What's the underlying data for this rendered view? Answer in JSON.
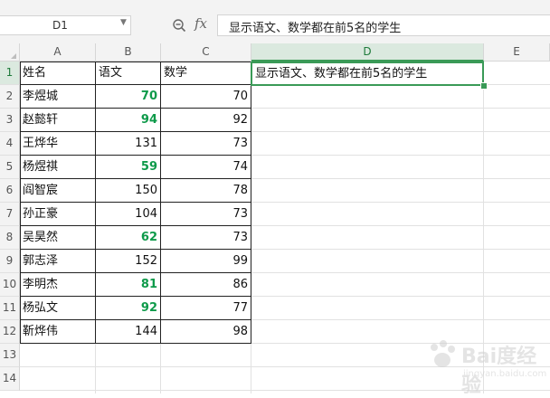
{
  "formula_bar": {
    "name_box": "D1",
    "fx_label": "fx",
    "formula": "显示语文、数学都在前5名的学生"
  },
  "columns": [
    "A",
    "B",
    "C",
    "D",
    "E"
  ],
  "active_column": "D",
  "rows": [
    "1",
    "2",
    "3",
    "4",
    "5",
    "6",
    "7",
    "8",
    "9",
    "10",
    "11",
    "12",
    "13",
    "14"
  ],
  "active_row": "1",
  "header": {
    "name": "姓名",
    "chinese": "语文",
    "math": "数学",
    "d1": "显示语文、数学都在前5名的学生"
  },
  "students": [
    {
      "name": "李煜城",
      "chinese": "70",
      "math": "70",
      "top5": true
    },
    {
      "name": "赵懿轩",
      "chinese": "94",
      "math": "92",
      "top5": true
    },
    {
      "name": "王烨华",
      "chinese": "131",
      "math": "73",
      "top5": false
    },
    {
      "name": "杨煜祺",
      "chinese": "59",
      "math": "74",
      "top5": true
    },
    {
      "name": "阎智宸",
      "chinese": "150",
      "math": "78",
      "top5": false
    },
    {
      "name": "孙正豪",
      "chinese": "104",
      "math": "73",
      "top5": false
    },
    {
      "name": "吴昊然",
      "chinese": "62",
      "math": "73",
      "top5": true
    },
    {
      "name": "郭志泽",
      "chinese": "152",
      "math": "99",
      "top5": false
    },
    {
      "name": "李明杰",
      "chinese": "81",
      "math": "86",
      "top5": true
    },
    {
      "name": "杨弘文",
      "chinese": "92",
      "math": "77",
      "top5": true
    },
    {
      "name": "靳烨伟",
      "chinese": "144",
      "math": "98",
      "top5": false
    }
  ],
  "highlight_color": "#0e9a4a",
  "selection_color": "#3a9a57",
  "watermark": {
    "main": "Bai度经验",
    "sub": "jingyan.baidu.com"
  }
}
